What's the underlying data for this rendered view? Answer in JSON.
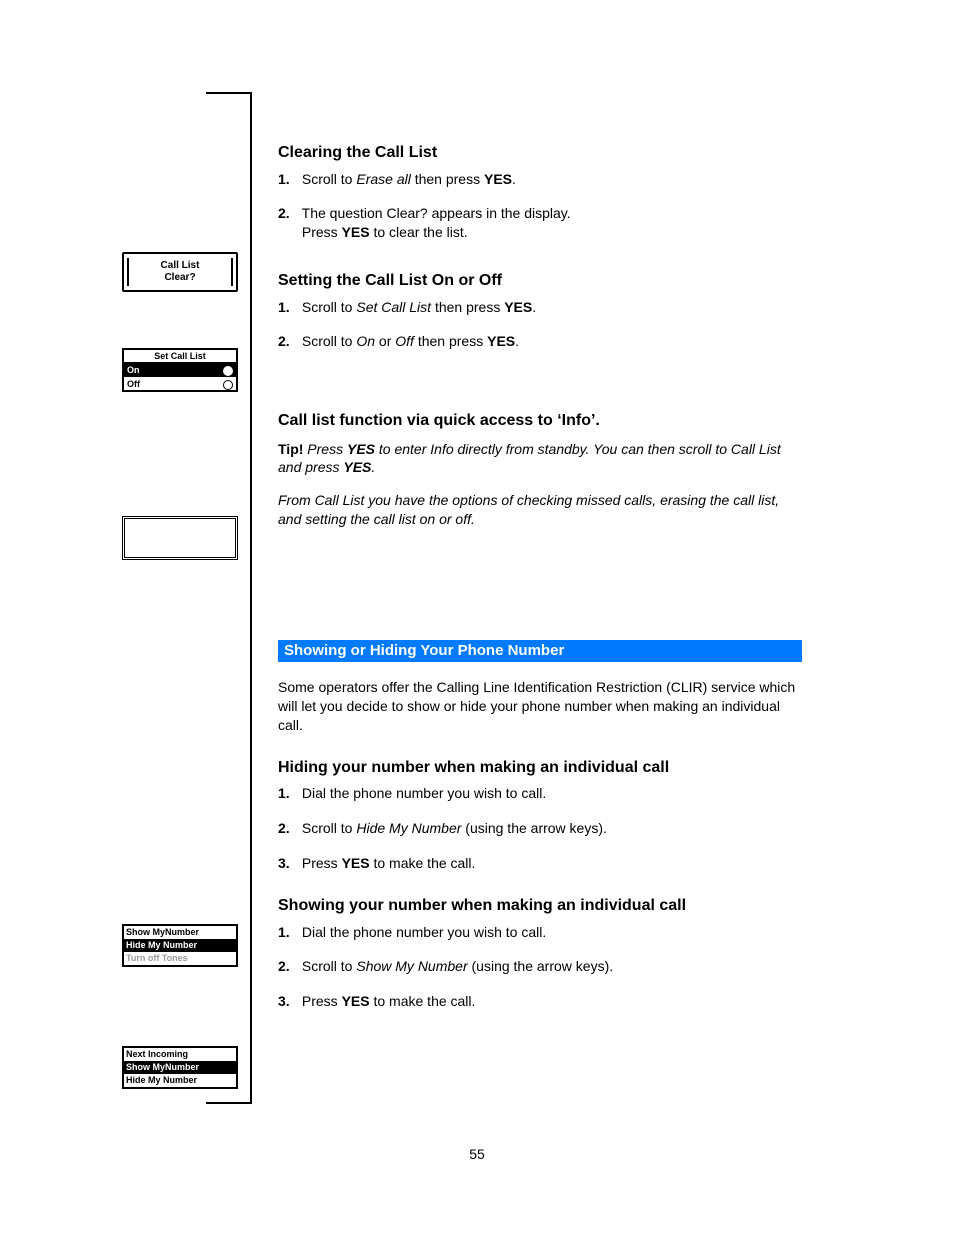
{
  "page_number": "55",
  "gutter": {
    "dialog": {
      "line1": "Call List",
      "line2": "Clear?"
    },
    "setlist": {
      "title": "Set Call List",
      "on": "On",
      "off": "Off"
    },
    "hide_screen": {
      "opt1": "Show MyNumber",
      "opt2": "Hide My Number",
      "opt3": "Turn off Tones"
    },
    "show_screen": {
      "opt1": "Next Incoming",
      "opt2": "Show MyNumber",
      "opt3": "Hide My Number"
    }
  },
  "clear_list": {
    "heading": "Clearing the Call List",
    "step1_pre": "Scroll to ",
    "step1_term": "Erase all",
    "step1_post": " then press ",
    "step1_key": "YES",
    "step1_end": ".",
    "step2_line": "The question Clear? appears in the display.",
    "step2_action_pre": "Press ",
    "step2_action_key": "YES",
    "step2_action_post": " to clear the list."
  },
  "set_list": {
    "heading": "Setting the Call List On or Off",
    "step1_pre": "Scroll to ",
    "step1_term": "Set Call List",
    "step1_post": " then press ",
    "step1_key": "YES",
    "step1_end": ".",
    "step2_pre": "Scroll to ",
    "step2_on": "On",
    "step2_or": " or ",
    "step2_off": "Off",
    "step2_post": " then press ",
    "step2_key": "YES",
    "step2_end": "."
  },
  "tip_section": {
    "heading": "Call list function via quick access to ‘Info’.",
    "tip_label": "Tip! ",
    "tip_text_1": "Press ",
    "tip_key1": "YES",
    "tip_text_2": " to enter ",
    "tip_term1": "Info",
    "tip_text_3": " directly from standby. You can then scroll to ",
    "tip_term2": "Call List",
    "tip_text_4": " and press ",
    "tip_key2": "YES",
    "tip_text_5": ".",
    "tip2_text_1": "From ",
    "tip2_term": "Call List",
    "tip2_text_2": " you have the options of checking missed calls, erasing the call list, and setting the call list on or off."
  },
  "section_bar": "Showing or Hiding Your Phone Number",
  "showhide": {
    "intro": "Some operators offer the Calling Line Identification Restriction (CLIR) service which will let you decide to show or hide your phone number when making an individual call.",
    "hide_heading": "Hiding your number when making an individual call",
    "hide_step1": "Dial the phone number you wish to call.",
    "hide_step2_pre": "Scroll to ",
    "hide_step2_term": "Hide My Number",
    "hide_step2_post": " (using the arrow keys).",
    "hide_step3_pre": "Press ",
    "hide_step3_key": "YES",
    "hide_step3_post": " to make the call.",
    "show_heading": "Showing your number when making an individual call",
    "show_step1": "Dial the phone number you wish to call.",
    "show_step2_pre": "Scroll to ",
    "show_step2_term": "Show My Number",
    "show_step2_post": " (using the arrow keys).",
    "show_step3_pre": "Press ",
    "show_step3_key": "YES",
    "show_step3_post": " to make the call."
  }
}
